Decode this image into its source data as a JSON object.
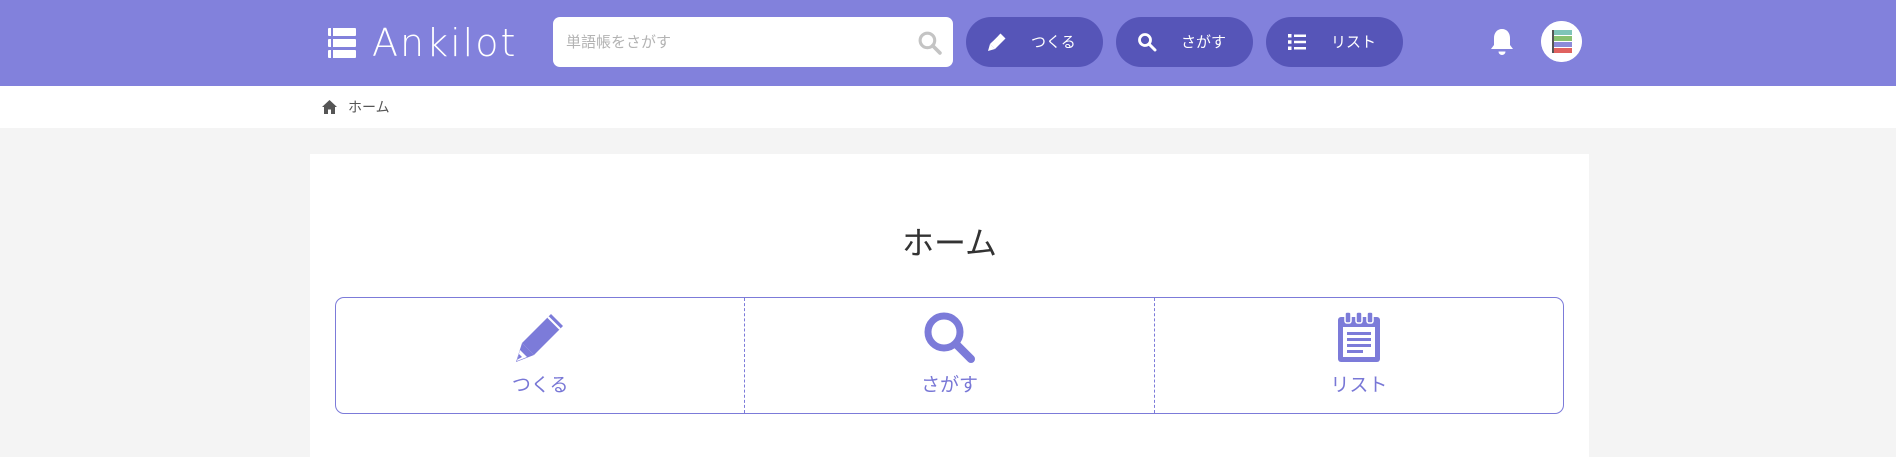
{
  "app": {
    "logo_text": "Ankilot"
  },
  "header": {
    "search_placeholder": "単語帳をさがす",
    "nav": {
      "create_label": "つくる",
      "search_label": "さがす",
      "list_label": "リスト"
    }
  },
  "breadcrumb": {
    "home_label": "ホーム"
  },
  "main": {
    "title": "ホーム",
    "menu": {
      "create_label": "つくる",
      "search_label": "さがす",
      "list_label": "リスト"
    }
  },
  "colors": {
    "header_bg": "#8281dc",
    "pill_bg": "#5655b8",
    "accent": "#7c7bd9",
    "page_bg": "#f4f4f4"
  },
  "icons": [
    "logo-book-icon",
    "search-icon",
    "pencil-icon",
    "list-icon",
    "bell-icon",
    "home-icon",
    "clipboard-icon"
  ]
}
